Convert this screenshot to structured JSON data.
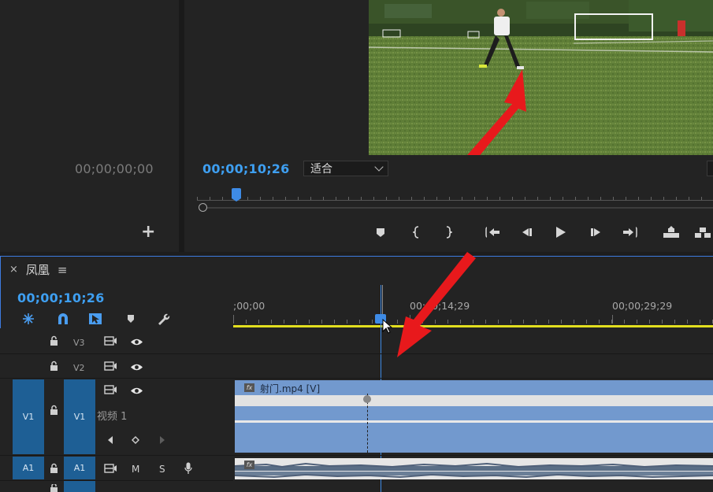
{
  "source_monitor": {
    "timecode": "00;00;00;00",
    "add_label": "+"
  },
  "program_monitor": {
    "timecode": "00;00;10;26",
    "fit_value": "适合"
  },
  "timeline": {
    "sequence_name": "凤凰",
    "close_label": "×",
    "menu_label": "≡",
    "timecode": "00;00;10;26",
    "ruler": {
      "labels": [
        ";00;00",
        "00;00;14;29",
        "00;00;29;29"
      ]
    },
    "tracks": {
      "v3": "V3",
      "v2": "V2",
      "v1_source": "V1",
      "v1": "V1",
      "v1_name": "视频 1",
      "a1_source": "A1",
      "a1": "A1",
      "a_mute": "M",
      "a_solo": "S"
    },
    "clip": {
      "video_name": "射门.mp4 [V]",
      "fx_label": "fx"
    }
  },
  "colors": {
    "accent_blue": "#3e9ff1",
    "track_target": "#1e5f95",
    "clip_video": "#7299ce",
    "work_area": "#e2de1f",
    "annotation_arrow": "#e8191c"
  },
  "icons": {
    "transport": [
      "add-marker-icon",
      "mark-in-icon",
      "mark-out-icon",
      "go-to-in-icon",
      "step-back-icon",
      "play-icon",
      "step-forward-icon",
      "go-to-out-icon",
      "lift-icon",
      "extract-icon"
    ],
    "timeline_tools": [
      "ripple-icon",
      "snap-magnet-icon",
      "linked-selection-icon",
      "add-marker-icon",
      "wrench-icon"
    ]
  }
}
